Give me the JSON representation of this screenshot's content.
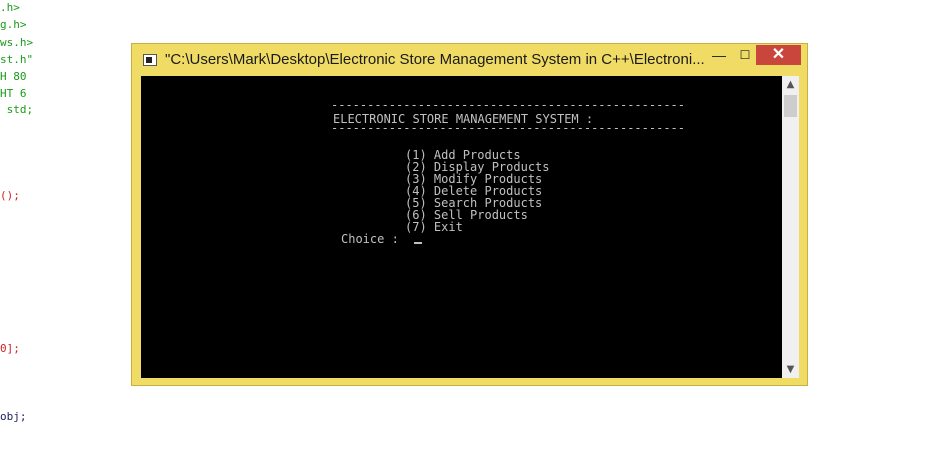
{
  "background_code": {
    "lines": [
      ".h>",
      "g.h>",
      "ws.h>",
      "st.h\"",
      "H 80",
      "HT 6",
      " std;",
      "();",
      "0];",
      "obj;"
    ]
  },
  "window": {
    "title": "\"C:\\Users\\Mark\\Desktop\\Electronic Store Management System in C++\\Electroni...",
    "minimize_glyph": "—",
    "maximize_glyph": "☐",
    "close_glyph": "✕",
    "app_icon": "console-app-icon"
  },
  "console": {
    "rule_top": "-------------------------------------------------",
    "heading": "ELECTRONIC STORE MANAGEMENT SYSTEM :",
    "rule_bottom": "-------------------------------------------------",
    "menu": [
      "(1) Add Products",
      "(2) Display Products",
      "(3) Modify Products",
      "(4) Delete Products",
      "(5) Search Products",
      "(6) Sell Products",
      "(7) Exit"
    ],
    "prompt": "Choice :"
  },
  "scrollbar": {
    "up_glyph": "▲",
    "down_glyph": "▼"
  },
  "colors": {
    "window_frame": "#f0dc64",
    "close_button": "#c9463d",
    "console_bg": "#000000",
    "console_text": "#c0c0c0",
    "code_green": "#1a9a1a",
    "code_red": "#cc2222"
  }
}
